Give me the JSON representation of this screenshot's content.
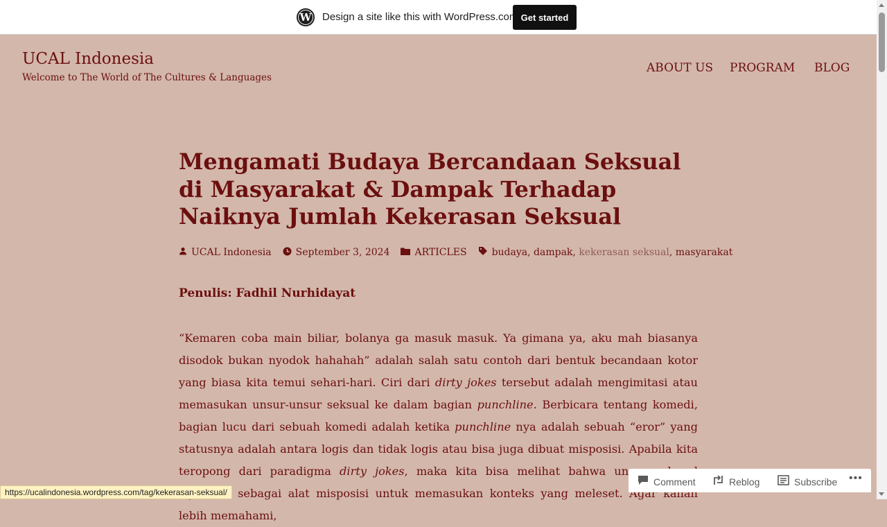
{
  "wp_banner": {
    "logo_letter": "W",
    "text": "Design a site like this with WordPress.com",
    "cta_label": "Get started"
  },
  "site": {
    "title": "UCAL Indonesia",
    "tagline": "Welcome to The World of The Cultures & Languages"
  },
  "nav": {
    "items": [
      "ABOUT US",
      "PROGRAM",
      "BLOG"
    ]
  },
  "post": {
    "title": "Mengamati Budaya Bercandaan Seksual di Masyarakat & Dampak Terhadap Naiknya Jumlah Kekerasan Seksual",
    "meta": {
      "author": "UCAL Indonesia",
      "date": "September 3, 2024",
      "category": "ARTICLES",
      "tags": [
        "budaya",
        "dampak",
        "kekerasan seksual",
        "masyarakat"
      ],
      "tag_separator": ","
    },
    "author_line": "Penulis: Fadhil Nurhidayat",
    "paragraph": {
      "p1": "“Kemaren coba main biliar, bolanya ga masuk masuk. Ya gimana ya, aku mah biasanya disodok bukan nyodok hahahah” adalah salah satu contoh dari bentuk becandaan kotor yang biasa kita temui sehari-hari. Ciri dari ",
      "i1": "dirty jokes",
      "p2": " tersebut adalah mengimitasi atau memasukan unsur-unsur seksual ke dalam bagian ",
      "i2": "punchline",
      "p3": ". Berbicara tentang komedi, bagian lucu dari sebuah komedi adalah ketika ",
      "i3": "punchline",
      "p4": " nya adalah sebuah “eror” yang statusnya adalah antara logis dan tidak logis atau bisa juga dibuat misposisi. Apabila kita teropong dari paradigma ",
      "i4": "dirty jokes",
      "p5": ", maka kita bisa melihat bahwa unsur seksual dijadikan sebagai alat misposisi untuk memasukan konteks yang meleset. Agar kalian lebih memahami,"
    }
  },
  "status_url": "https://ucalindonesia.wordpress.com/tag/kekerasan-seksual/",
  "actionbar": {
    "comment": "Comment",
    "reblog": "Reblog",
    "subscribe": "Subscribe",
    "more": "•••"
  },
  "colors": {
    "background": "#d3b7ab",
    "text": "#6b0f0f",
    "muted_tag": "#8f5a52"
  }
}
